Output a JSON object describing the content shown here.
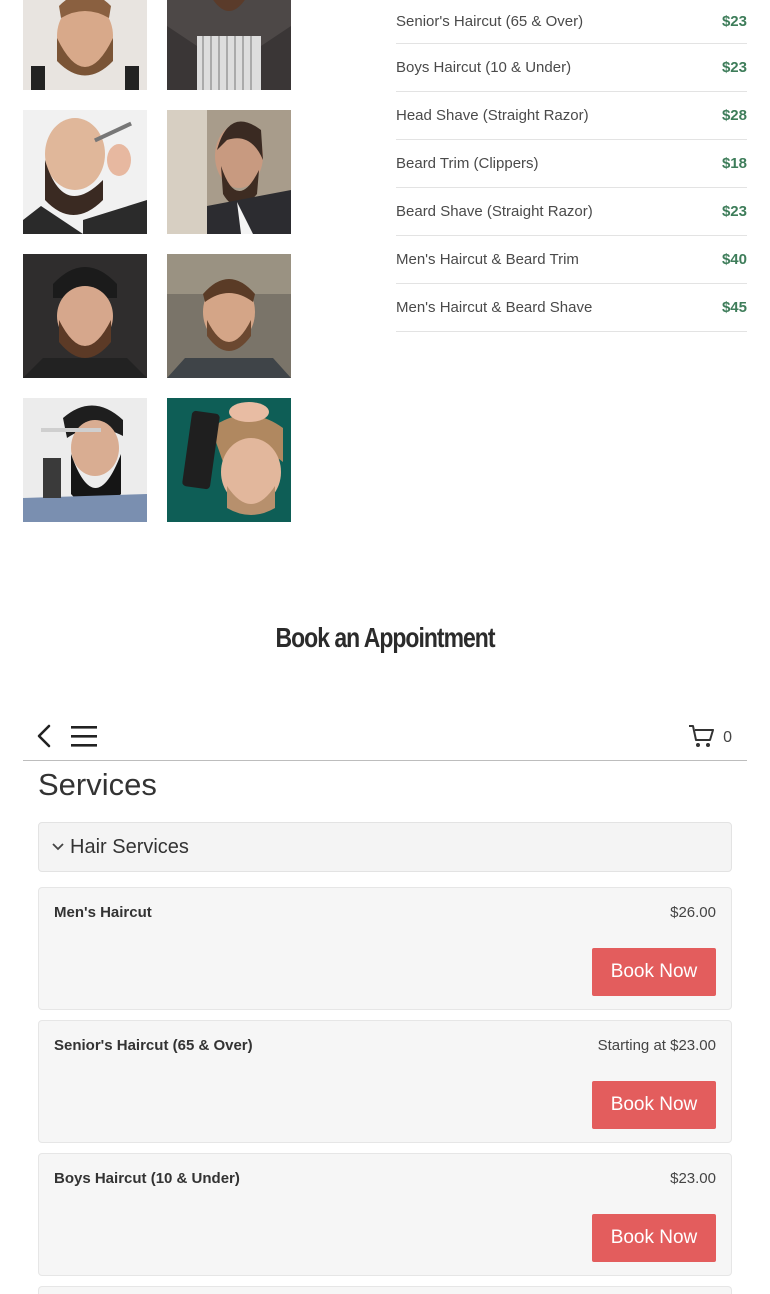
{
  "gallery": {
    "images": [
      {
        "subject": "man-with-full-beard-suspenders"
      },
      {
        "subject": "bearded-man-striped-shirt"
      },
      {
        "subject": "man-trimming-beard-with-razor"
      },
      {
        "subject": "bearded-man-profile"
      },
      {
        "subject": "man-with-beanie-and-beard"
      },
      {
        "subject": "man-with-styled-beard"
      },
      {
        "subject": "man-holding-straight-razor"
      },
      {
        "subject": "man-getting-hair-combed"
      }
    ]
  },
  "price_list": [
    {
      "name": "Senior's Haircut (65 & Over)",
      "price": "$23"
    },
    {
      "name": "Boys Haircut (10 & Under)",
      "price": "$23"
    },
    {
      "name": "Head Shave (Straight Razor)",
      "price": "$28"
    },
    {
      "name": "Beard Trim (Clippers)",
      "price": "$18"
    },
    {
      "name": "Beard Shave (Straight Razor)",
      "price": "$23"
    },
    {
      "name": "Men's Haircut & Beard Trim",
      "price": "$40"
    },
    {
      "name": "Men's Haircut & Beard Shave",
      "price": "$45"
    }
  ],
  "booking": {
    "heading": "Book an Appointment",
    "cart_count": "0",
    "services_title": "Services",
    "category_label": "Hair Services",
    "services": [
      {
        "name": "Men's Haircut",
        "price": "$26.00",
        "button": "Book Now"
      },
      {
        "name": "Senior's Haircut (65 & Over)",
        "price": "Starting at $23.00",
        "button": "Book Now"
      },
      {
        "name": "Boys Haircut (10 & Under)",
        "price": "$23.00",
        "button": "Book Now"
      }
    ]
  },
  "colors": {
    "price_green": "#3e7d5a",
    "button_red": "#e35d5d"
  }
}
